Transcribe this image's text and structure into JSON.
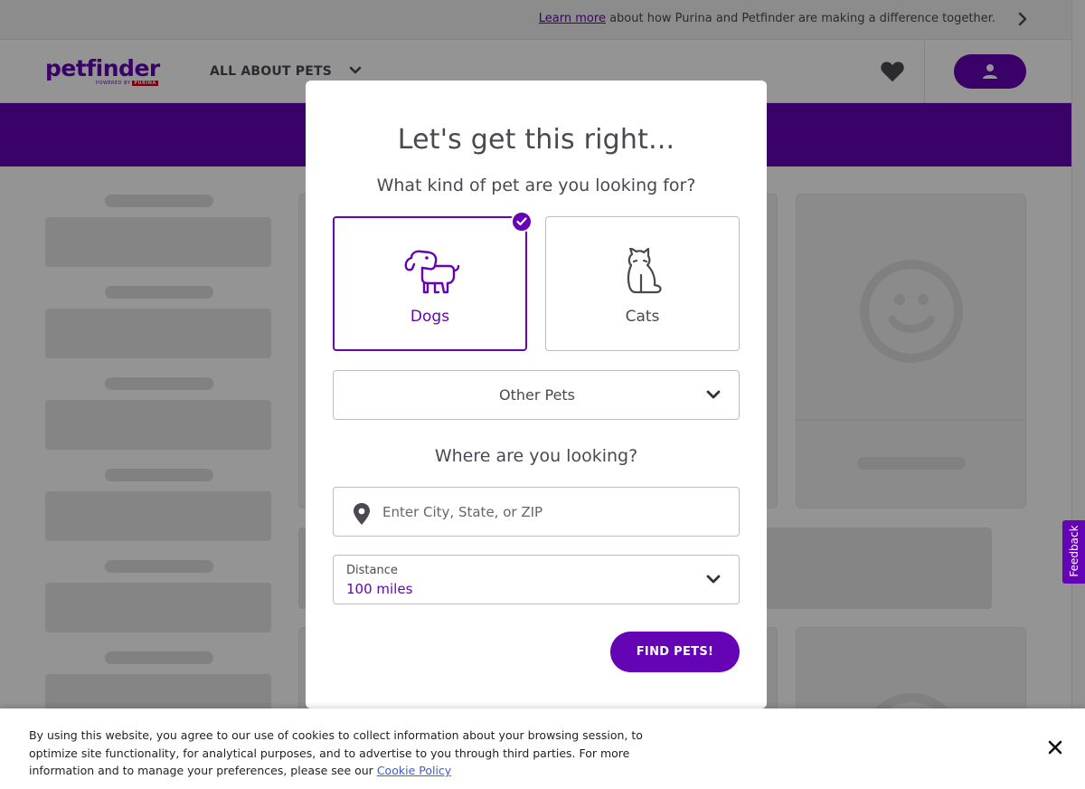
{
  "promo": {
    "link_text": "Learn more",
    "text": "about how Purina and Petfinder are making a difference together."
  },
  "header": {
    "logo_text": "petfinder",
    "logo_sub": "POWERED BY",
    "logo_sub_brand": "PURINA",
    "nav_all_about": "ALL ABOUT PETS"
  },
  "modal": {
    "title": "Let's get this right...",
    "question_pet": "What kind of pet are you looking for?",
    "pet_options": [
      {
        "label": "Dogs",
        "selected": true
      },
      {
        "label": "Cats",
        "selected": false
      }
    ],
    "other_pets_label": "Other Pets",
    "question_location": "Where are you looking?",
    "location_placeholder": "Enter City, State, or ZIP",
    "location_value": "",
    "distance_label": "Distance",
    "distance_value": "100 miles",
    "find_button": "FIND PETS!"
  },
  "feedback_label": "Feedback",
  "cookie": {
    "text": "By using this website, you agree to our use of cookies to collect information about your browsing session, to optimize site functionality, for analytical purposes, and to advertise to you through third parties. For more information and to manage your preferences, please see our",
    "link_text": "Cookie Policy"
  },
  "colors": {
    "brand_purple": "#6504b5",
    "text_dark": "#4d4751",
    "border_gray": "#bdbdbd"
  },
  "icons": {
    "promo_chevron": "chevron-right-icon",
    "nav_chevron": "chevron-down-icon",
    "favorites": "heart-icon",
    "account": "user-icon",
    "selected_check": "checkmark-icon",
    "dog": "dog-icon",
    "cat": "cat-icon",
    "location": "location-pin-icon",
    "close": "close-icon"
  }
}
